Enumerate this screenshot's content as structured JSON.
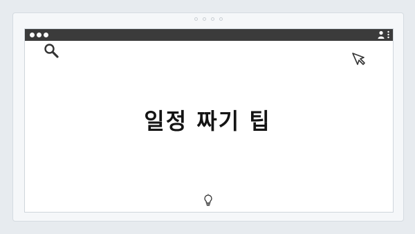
{
  "carousel": {
    "dots": [
      "slide-1",
      "slide-2",
      "slide-3",
      "slide-4"
    ]
  },
  "browser": {
    "window_controls": [
      "dot",
      "dot",
      "dot"
    ],
    "icons": [
      "profile-icon",
      "kebab-menu-icon"
    ]
  },
  "slide": {
    "title": "일정 짜기 팁",
    "icons": [
      "search-icon",
      "cursor-arrow-icon",
      "lightbulb-icon"
    ]
  },
  "colors": {
    "background": "#e7ebef",
    "titlebar": "#3b3b3b",
    "window": "#ffffff",
    "title_text": "#141414",
    "icon_stroke": "#333333"
  }
}
